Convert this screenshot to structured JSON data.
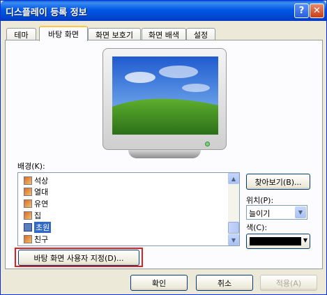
{
  "window": {
    "title": "디스플레이 등록 정보",
    "help_label": "?",
    "close_label": "✕"
  },
  "tabs": [
    {
      "label": "테마"
    },
    {
      "label": "바탕 화면",
      "active": true
    },
    {
      "label": "화면 보호기"
    },
    {
      "label": "화면 배색"
    },
    {
      "label": "설정"
    }
  ],
  "background": {
    "label": "배경(K):",
    "items": [
      {
        "label": "석상",
        "icon": "image-file-icon"
      },
      {
        "label": "열대",
        "icon": "image-file-icon"
      },
      {
        "label": "유연",
        "icon": "image-file-icon"
      },
      {
        "label": "집",
        "icon": "image-file-icon"
      },
      {
        "label": "초원",
        "icon": "image-file-icon",
        "selected": true
      },
      {
        "label": "친구",
        "icon": "image-file-icon"
      }
    ],
    "scroll_up": "▲",
    "scroll_down": "▼"
  },
  "browse_button": "찾아보기(B)...",
  "position": {
    "label": "위치(P):",
    "value": "늘이기"
  },
  "color": {
    "label": "색(C):",
    "value": "#000000"
  },
  "customize_button": "바탕 화면 사용자 지정(D)...",
  "footer": {
    "ok": "확인",
    "cancel": "취소",
    "apply": "적용(A)"
  },
  "colors": {
    "highlight_box": "#e02020",
    "selection": "#316ac5",
    "titlebar": "#0058e6"
  }
}
